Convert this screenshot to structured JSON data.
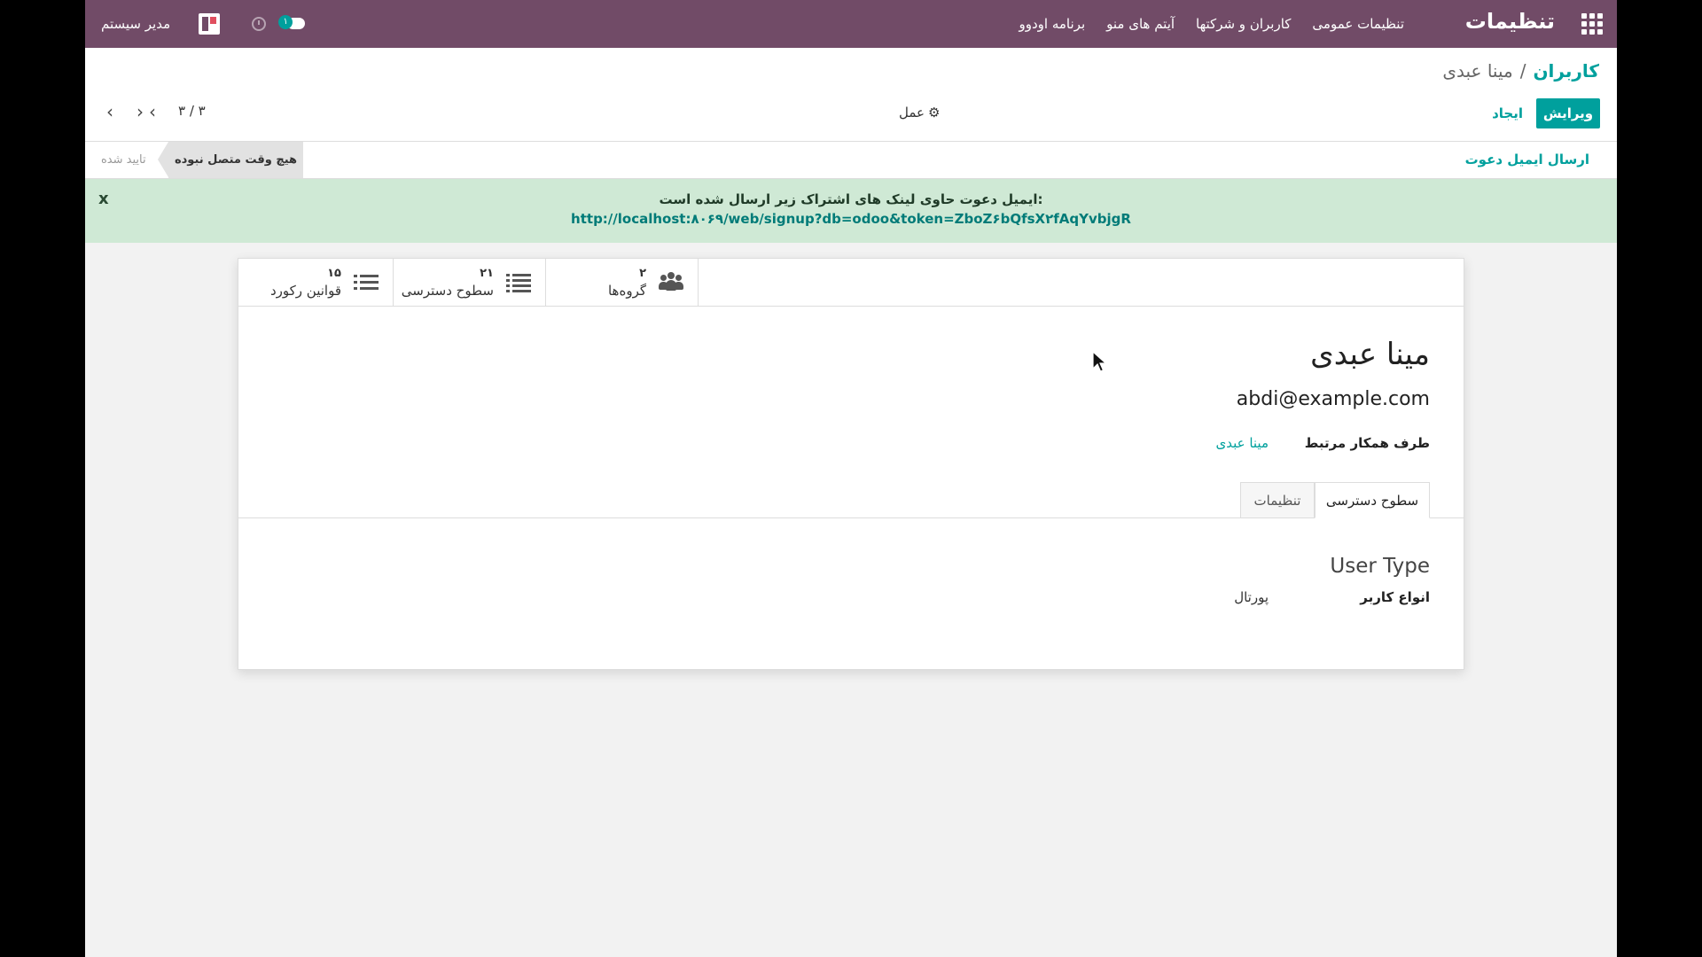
{
  "navbar": {
    "brand": "تنظیمات",
    "menu": [
      "تنظیمات عمومی",
      "کاربران و شرکتها",
      "آیتم های منو",
      "برنامه اودوو"
    ],
    "chat_badge": "۱",
    "user_name": "مدیر سیستم",
    "icons": [
      "apps-grid-icon",
      "chat-icon",
      "clock-icon",
      "avatar"
    ]
  },
  "breadcrumb": {
    "parent": "کاربران",
    "separator": "/",
    "current": "مینا عبدی"
  },
  "actions": {
    "edit": "ویرایش",
    "create": "ایجاد",
    "action": "عمل"
  },
  "pager": {
    "value": "۳ / ۳"
  },
  "statusbar": {
    "invite_button": "ارسال ایمیل دعوت",
    "stages": [
      {
        "label": "هیچ وقت متصل نبوده",
        "active": true
      },
      {
        "label": "تایید شده",
        "active": false
      }
    ]
  },
  "alert": {
    "close": "x",
    "message": "ایمیل دعوت حاوی لینک های اشتراک زیر ارسال شده است:",
    "link": "http://localhost:۸۰۶۹/web/signup?db=odoo&token=ZboZ۶bQfsX۲fAqYvbjgR"
  },
  "smart_buttons": [
    {
      "count": "۲",
      "label": "گروه‌ها",
      "icon": "users-icon"
    },
    {
      "count": "۲۱",
      "label": "سطوح دسترسی",
      "icon": "list-icon"
    },
    {
      "count": "۱۵",
      "label": "قوانین رکورد",
      "icon": "list-icon"
    }
  ],
  "record": {
    "name": "مینا عبدی",
    "email": "abdi@example.com",
    "partner_label": "طرف همکار مرتبط",
    "partner_value": "مینا عبدی"
  },
  "tabs": [
    {
      "label": "سطوح دسترسی",
      "active": true
    },
    {
      "label": "تنظیمات",
      "active": false
    }
  ],
  "access": {
    "group_title": "User Type",
    "user_type_label": "انواع کاربر",
    "user_type_value": "پورتال"
  },
  "colors": {
    "navbar": "#714b67",
    "accent": "#00a09d",
    "alert_bg": "#cfe9d5"
  }
}
